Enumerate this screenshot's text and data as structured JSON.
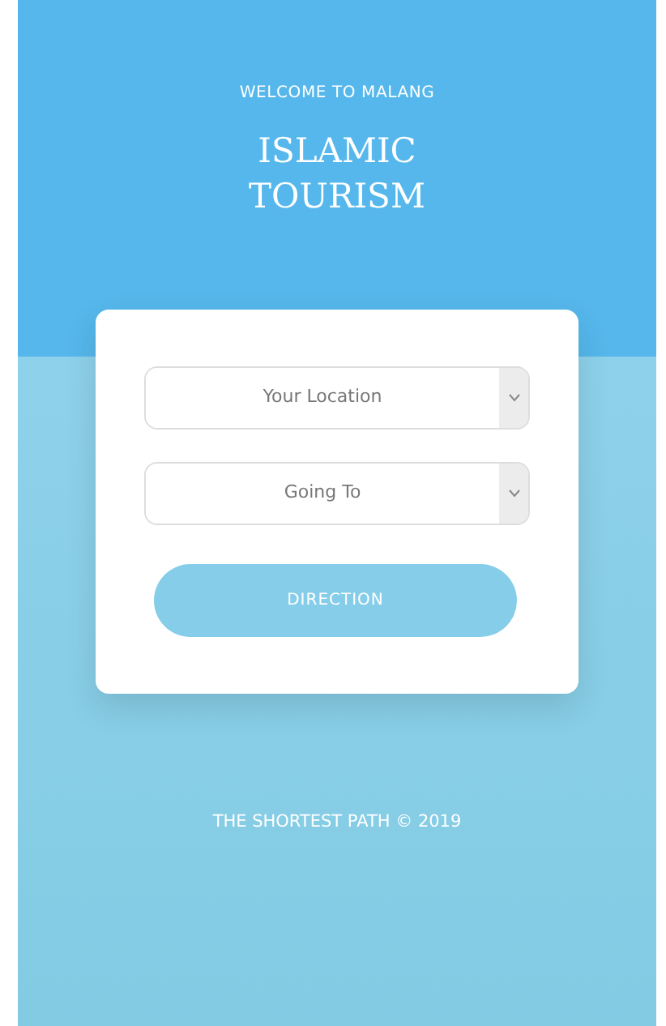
{
  "header": {
    "subtitle": "WELCOME TO MALANG",
    "title": "ISLAMIC TOURISM"
  },
  "form": {
    "selects": [
      {
        "placeholder": "Your Location"
      },
      {
        "placeholder": "Going To"
      }
    ],
    "button": "DIRECTION"
  },
  "footer": "THE SHORTEST PATH © 2019"
}
